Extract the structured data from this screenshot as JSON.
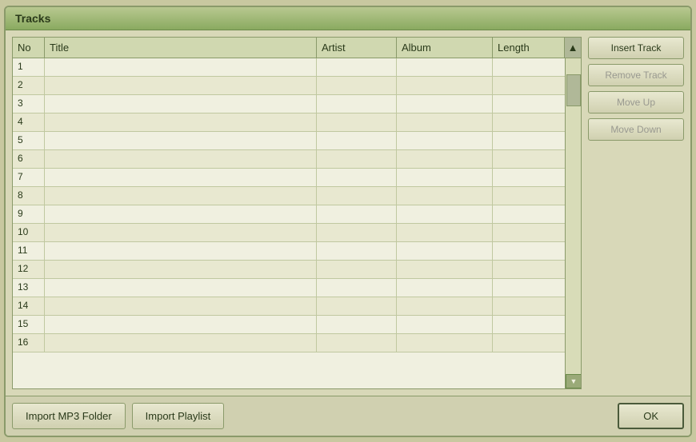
{
  "dialog": {
    "title": "Tracks"
  },
  "table": {
    "headers": [
      {
        "label": "No",
        "key": "no"
      },
      {
        "label": "Title",
        "key": "title"
      },
      {
        "label": "Artist",
        "key": "artist"
      },
      {
        "label": "Album",
        "key": "album"
      },
      {
        "label": "Length",
        "key": "length"
      }
    ],
    "rows": [
      {
        "no": "1",
        "title": "",
        "artist": "",
        "album": "",
        "length": ""
      },
      {
        "no": "2",
        "title": "",
        "artist": "",
        "album": "",
        "length": ""
      },
      {
        "no": "3",
        "title": "",
        "artist": "",
        "album": "",
        "length": ""
      },
      {
        "no": "4",
        "title": "",
        "artist": "",
        "album": "",
        "length": ""
      },
      {
        "no": "5",
        "title": "",
        "artist": "",
        "album": "",
        "length": ""
      },
      {
        "no": "6",
        "title": "",
        "artist": "",
        "album": "",
        "length": ""
      },
      {
        "no": "7",
        "title": "",
        "artist": "",
        "album": "",
        "length": ""
      },
      {
        "no": "8",
        "title": "",
        "artist": "",
        "album": "",
        "length": ""
      },
      {
        "no": "9",
        "title": "",
        "artist": "",
        "album": "",
        "length": ""
      },
      {
        "no": "10",
        "title": "",
        "artist": "",
        "album": "",
        "length": ""
      },
      {
        "no": "11",
        "title": "",
        "artist": "",
        "album": "",
        "length": ""
      },
      {
        "no": "12",
        "title": "",
        "artist": "",
        "album": "",
        "length": ""
      },
      {
        "no": "13",
        "title": "",
        "artist": "",
        "album": "",
        "length": ""
      },
      {
        "no": "14",
        "title": "",
        "artist": "",
        "album": "",
        "length": ""
      },
      {
        "no": "15",
        "title": "",
        "artist": "",
        "album": "",
        "length": ""
      },
      {
        "no": "16",
        "title": "",
        "artist": "",
        "album": "",
        "length": ""
      }
    ]
  },
  "buttons": {
    "insert_track": "Insert Track",
    "remove_track": "Remove Track",
    "move_up": "Move Up",
    "move_down": "Move Down",
    "import_mp3": "Import MP3 Folder",
    "import_playlist": "Import Playlist",
    "ok": "OK"
  }
}
